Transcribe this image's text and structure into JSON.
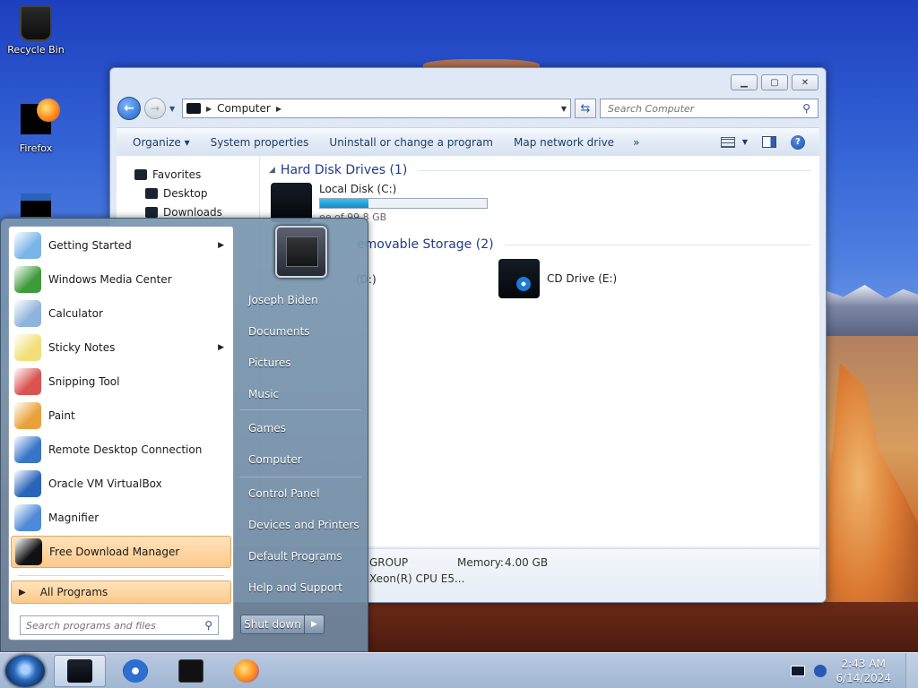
{
  "desktop": {
    "icons": [
      {
        "label": "Recycle Bin"
      },
      {
        "label": "Firefox"
      }
    ]
  },
  "explorer": {
    "address": {
      "crumb": "Computer"
    },
    "search": {
      "placeholder": "Search Computer"
    },
    "commands": {
      "organize": "Organize",
      "system_properties": "System properties",
      "uninstall": "Uninstall or change a program",
      "map_drive": "Map network drive",
      "more": "»"
    },
    "nav": {
      "favorites": "Favorites",
      "desktop": "Desktop",
      "downloads": "Downloads"
    },
    "groups": {
      "hdd": "Hard Disk Drives (1)",
      "removable": "emovable Storage (2)"
    },
    "drives": {
      "c": {
        "name": "Local Disk (C:)",
        "used_fraction": 0.29,
        "free_text": "ee of 99.8 GB"
      },
      "d": {
        "name": "(D:)"
      },
      "e": {
        "name": "CD Drive (E:)"
      }
    },
    "details": {
      "workgroup": "GROUP",
      "memory_label": "Memory:",
      "memory_value": "4.00 GB",
      "processor": "Xeon(R) CPU E5..."
    }
  },
  "start_menu": {
    "programs": [
      {
        "label": "Getting Started",
        "submenu": true,
        "color": "#7ab4e8"
      },
      {
        "label": "Windows Media Center",
        "submenu": false,
        "color": "#3f9b3a"
      },
      {
        "label": "Calculator",
        "submenu": false,
        "color": "#8fb4dc"
      },
      {
        "label": "Sticky Notes",
        "submenu": true,
        "color": "#f3e07a"
      },
      {
        "label": "Snipping Tool",
        "submenu": false,
        "color": "#d9534f"
      },
      {
        "label": "Paint",
        "submenu": false,
        "color": "#e9a23b"
      },
      {
        "label": "Remote Desktop Connection",
        "submenu": false,
        "color": "#3875c9"
      },
      {
        "label": "Oracle VM VirtualBox",
        "submenu": false,
        "color": "#2864b9"
      },
      {
        "label": "Magnifier",
        "submenu": false,
        "color": "#4f8ad8"
      },
      {
        "label": "Free Download Manager",
        "submenu": false,
        "color": "#111111"
      }
    ],
    "all_programs": "All Programs",
    "search": {
      "placeholder": "Search programs and files"
    },
    "right_links": [
      "Joseph Biden",
      "Documents",
      "Pictures",
      "Music",
      "Games",
      "Computer",
      "Control Panel",
      "Devices and Printers",
      "Default Programs",
      "Help and Support"
    ],
    "shutdown": "Shut down"
  },
  "taskbar": {
    "time": "2:43 AM",
    "date": "6/14/2024"
  }
}
